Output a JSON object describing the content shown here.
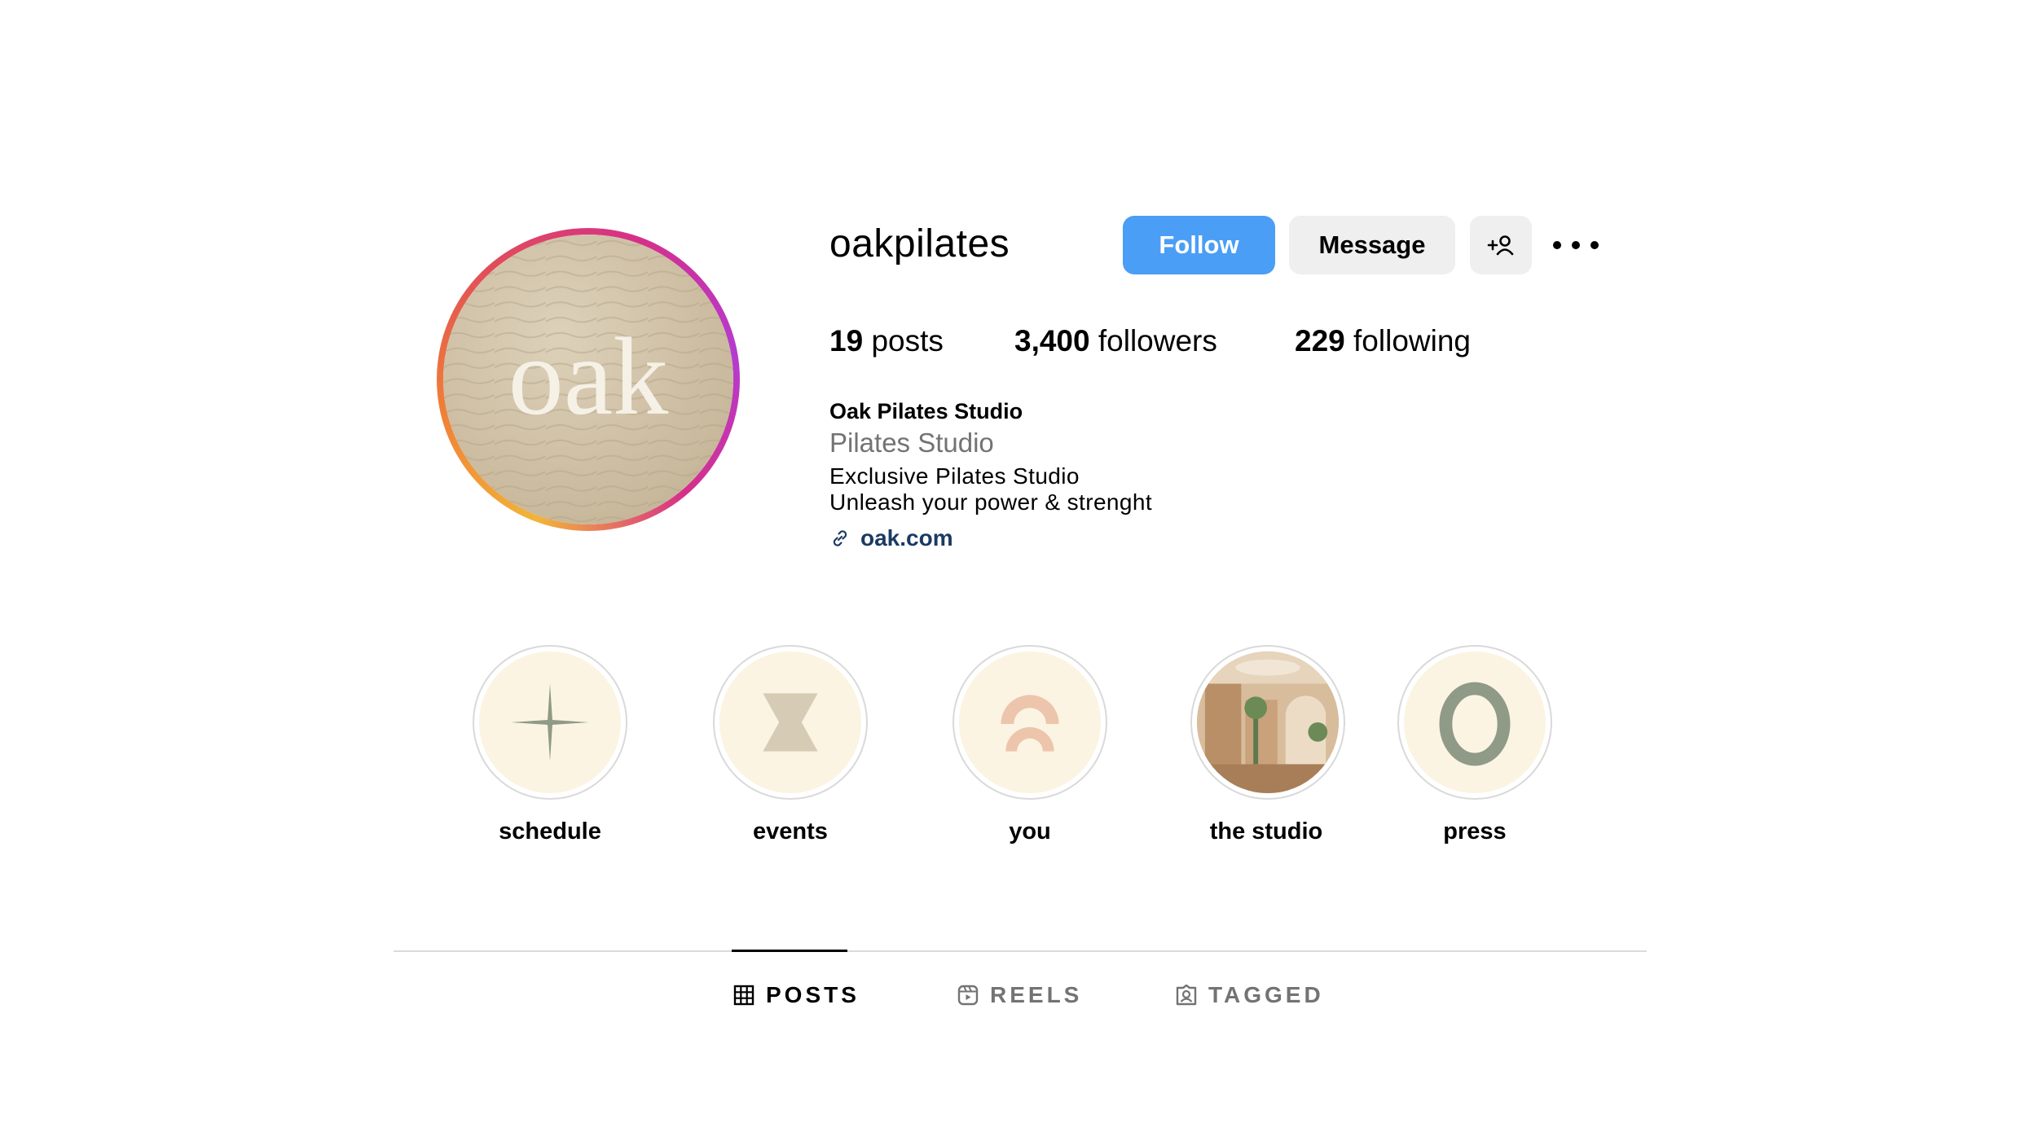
{
  "profile": {
    "username": "oakpilates",
    "avatar_logo_text": "oak",
    "buttons": {
      "follow": "Follow",
      "message": "Message",
      "add_user_icon": "person-add-icon",
      "more_icon": "more-horizontal-icon"
    },
    "stats": {
      "posts_count": "19",
      "posts_label": "posts",
      "followers_count": "3,400",
      "followers_label": "followers",
      "following_count": "229",
      "following_label": "following"
    },
    "bio": {
      "name": "Oak Pilates Studio",
      "category": "Pilates Studio",
      "line1": "Exclusive Pilates Studio",
      "line2": "Unleash your power & strenght",
      "link_icon": "link-icon",
      "link": "oak.com"
    }
  },
  "highlights": [
    {
      "label": "schedule",
      "icon": "sparkle-icon"
    },
    {
      "label": "events",
      "icon": "hourglass-icon"
    },
    {
      "label": "you",
      "icon": "arch-icon"
    },
    {
      "label": "the studio",
      "icon": "studio-photo"
    },
    {
      "label": "press",
      "icon": "letter-o-icon"
    }
  ],
  "tabs": [
    {
      "label": "POSTS",
      "icon": "grid-icon",
      "active": true
    },
    {
      "label": "REELS",
      "icon": "reels-icon",
      "active": false
    },
    {
      "label": "TAGGED",
      "icon": "tagged-icon",
      "active": false
    }
  ],
  "colors": {
    "follow_button": "#4a9ef5",
    "secondary_button": "#efefef",
    "highlight_bg": "#fbf4e3",
    "link_text": "#1b3a63",
    "muted_text": "#737373"
  }
}
